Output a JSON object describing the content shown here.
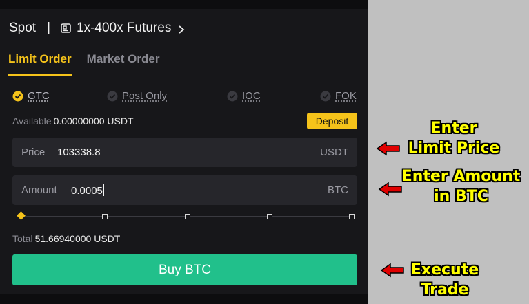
{
  "header": {
    "spot_label": "Spot",
    "separator": "|",
    "futures_label": "1x-400x Futures"
  },
  "tabs": [
    {
      "label": "Limit Order",
      "active": true
    },
    {
      "label": "Market Order",
      "active": false
    }
  ],
  "time_in_force": [
    {
      "label": "GTC",
      "selected": true
    },
    {
      "label": "Post Only",
      "selected": false
    },
    {
      "label": "IOC",
      "selected": false
    },
    {
      "label": "FOK",
      "selected": false
    }
  ],
  "available": {
    "label": "Available",
    "value": "0.00000000 USDT"
  },
  "deposit_label": "Deposit",
  "price_field": {
    "label": "Price",
    "value": "103338.8",
    "unit": "USDT"
  },
  "amount_field": {
    "label": "Amount",
    "value": "0.0005",
    "unit": "BTC"
  },
  "slider": {
    "value_fraction": 0,
    "steps": [
      0,
      0.25,
      0.5,
      0.75,
      1
    ]
  },
  "total": {
    "label": "Total",
    "value": "51.66940000 USDT"
  },
  "buy_button_label": "Buy BTC",
  "annotations": {
    "price": [
      "Enter",
      "Limit Price"
    ],
    "amount": [
      "Enter Amount",
      "in BTC"
    ],
    "execute": [
      "Execute",
      "Trade"
    ]
  },
  "colors": {
    "accent": "#f5c31a",
    "buy": "#21c08b",
    "panel_bg": "#17171a",
    "field_bg": "#26262b",
    "annotation_text": "#ffff00",
    "annotation_arrow": "#e00000"
  },
  "icons": [
    "futures-icon",
    "chevron-right-icon",
    "check-circle-icon",
    "red-arrow-icon"
  ]
}
